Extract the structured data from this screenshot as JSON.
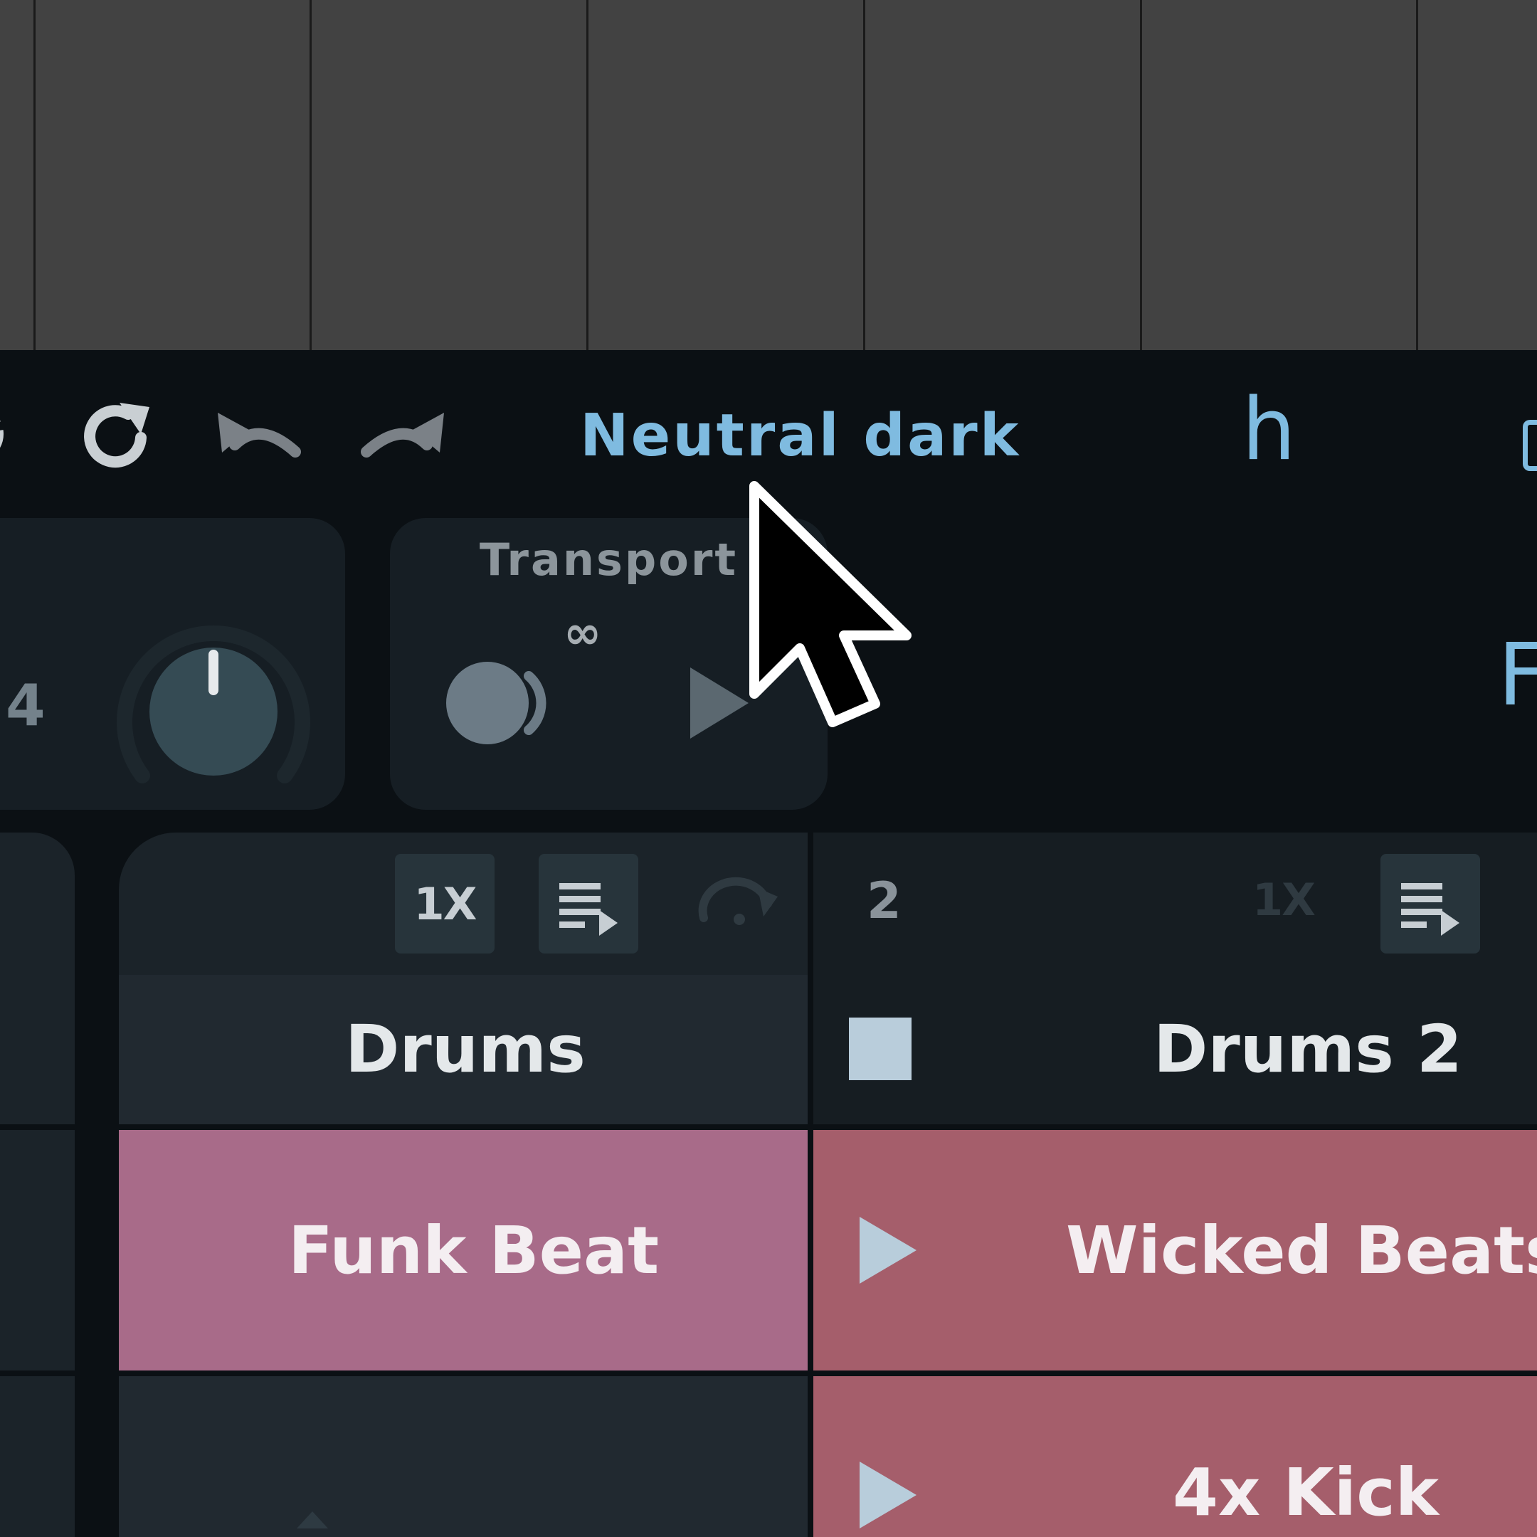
{
  "toolbar": {
    "theme_name": "Neutral dark",
    "h_label": "h",
    "right_partial_label": "F",
    "icons": [
      "settings-icon",
      "refresh-icon",
      "undo-icon",
      "redo-icon",
      "device-icon"
    ]
  },
  "tempo_panel": {
    "number": "4",
    "knob_icon": "tempo-knob"
  },
  "transport": {
    "title": "Transport",
    "loop_symbol": "∞",
    "icons": [
      "record-icon",
      "play-icon"
    ]
  },
  "tracks": [
    {
      "name": "Drums",
      "header": {
        "speed": "1X",
        "icons": [
          "queue-play-icon",
          "follow-action-icon"
        ]
      },
      "clips": [
        {
          "name": "Funk Beat",
          "color": "#a86b89"
        },
        {
          "name": "",
          "color": "#212930"
        }
      ]
    },
    {
      "number": "2",
      "name": "Drums 2",
      "header": {
        "speed": "1X",
        "icons": [
          "queue-play-icon"
        ]
      },
      "stop_icon": "stop-icon",
      "clips": [
        {
          "name": "Wicked Beats",
          "color": "#a55e6b"
        },
        {
          "name": "4x Kick",
          "color": "#a55e6b"
        }
      ]
    }
  ],
  "colors": {
    "accent": "#7fbbe0",
    "background": "#0b1014",
    "panel": "#161e24",
    "clip_pink": "#a86b89",
    "clip_red": "#a55e6b"
  }
}
